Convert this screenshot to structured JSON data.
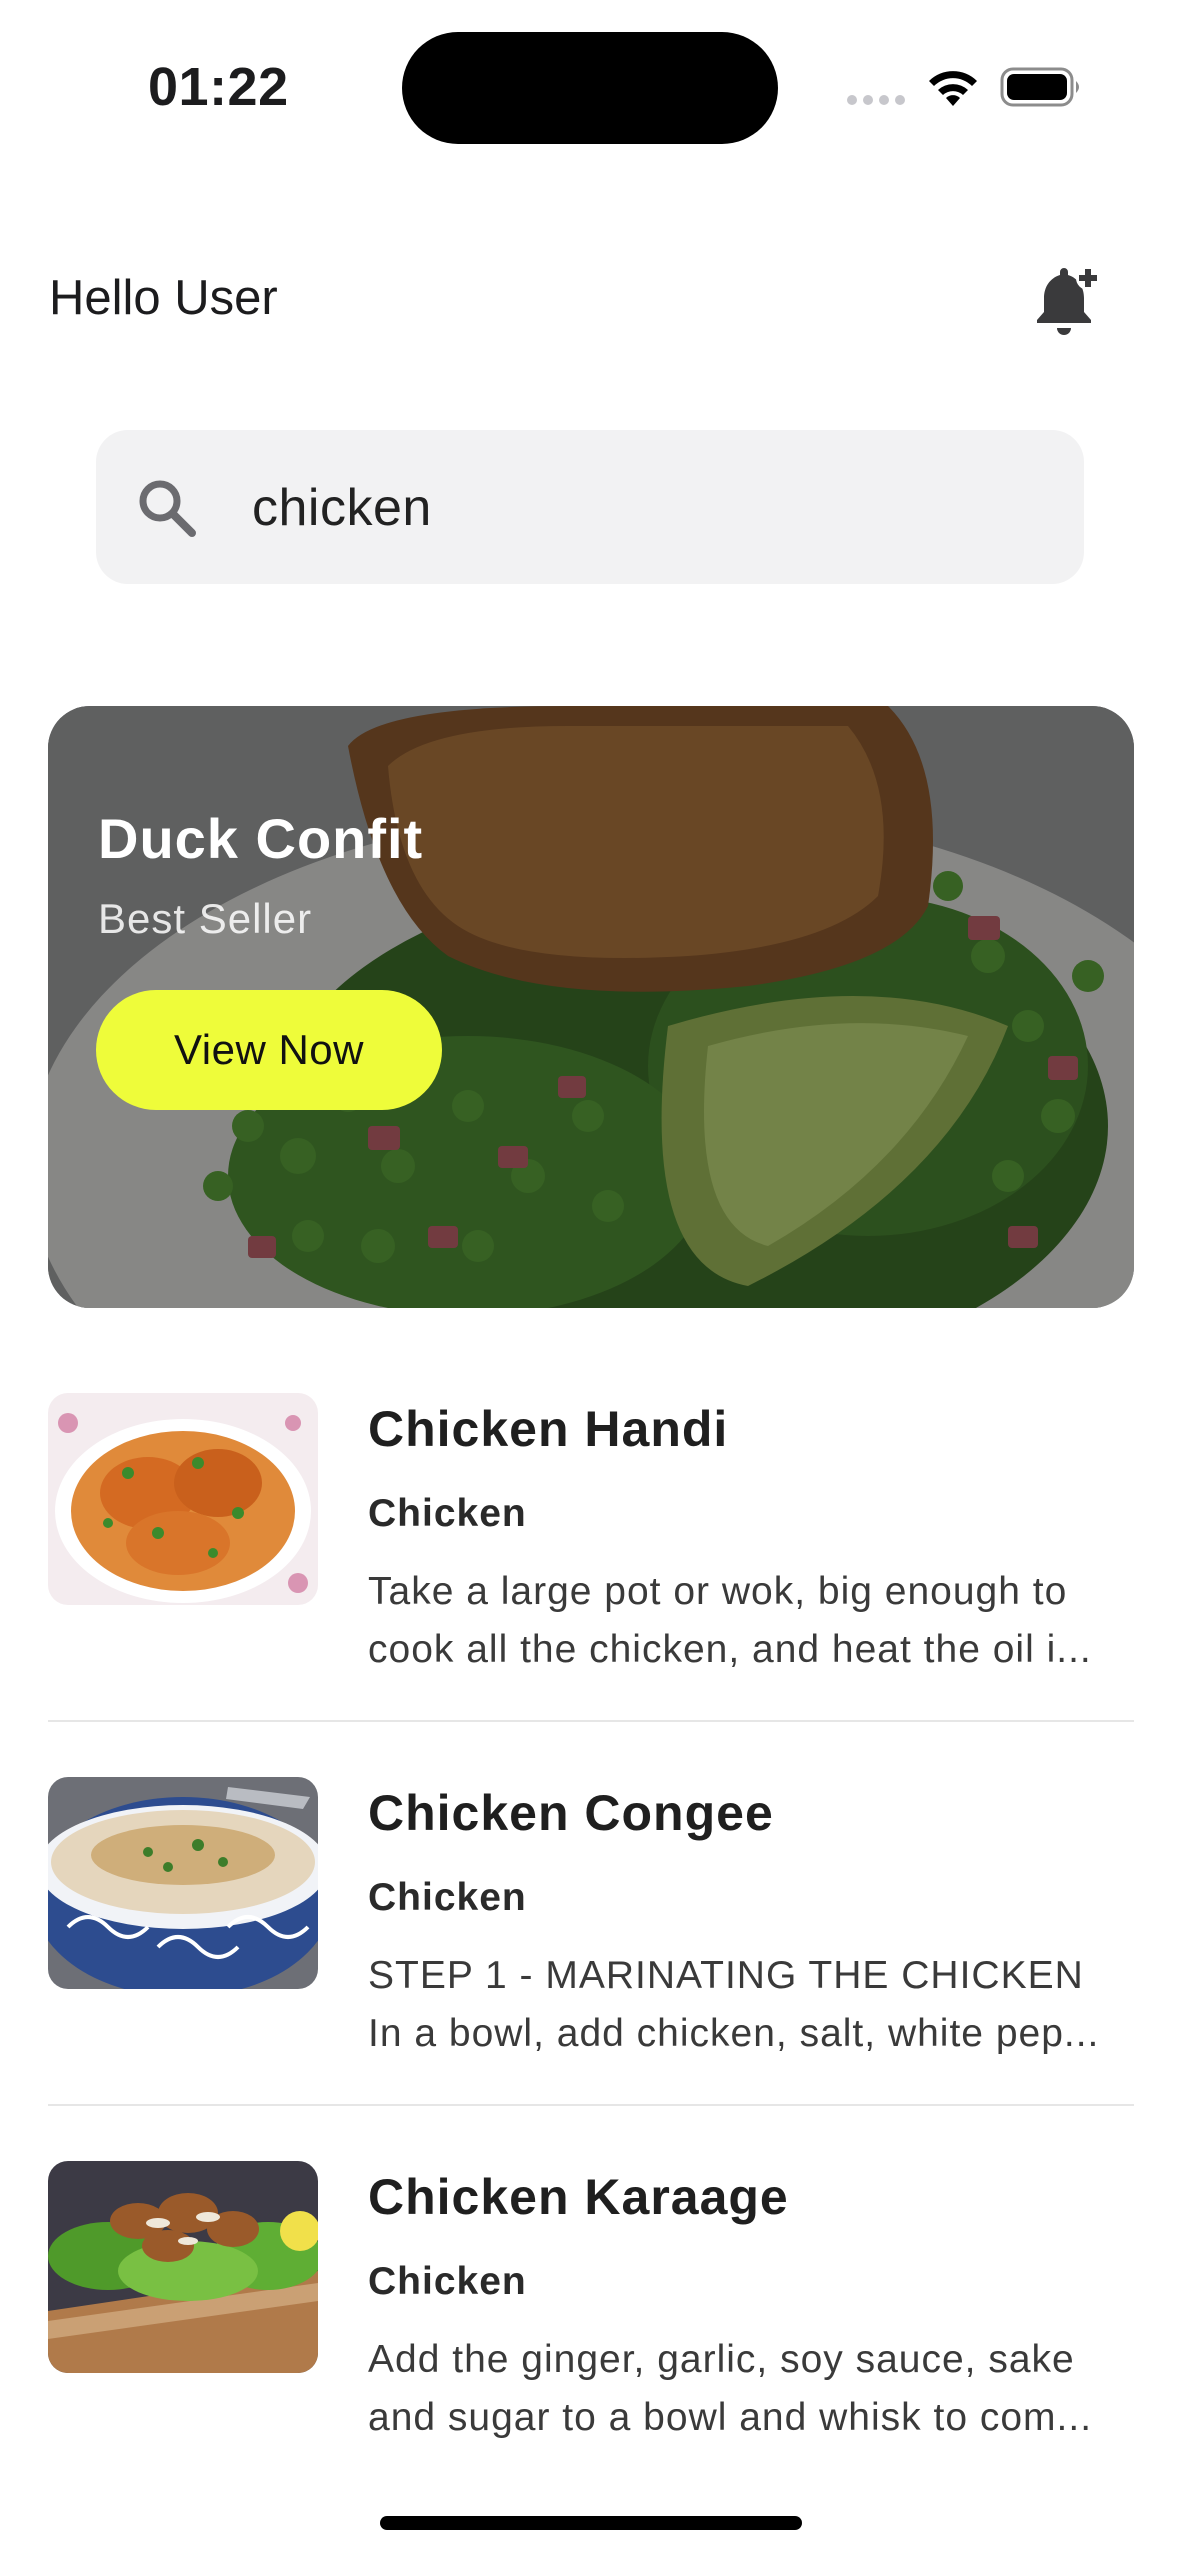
{
  "status_bar": {
    "time": "01:22"
  },
  "header": {
    "greeting": "Hello User",
    "bell_icon": "bell-plus-icon"
  },
  "search": {
    "value": "chicken",
    "placeholder": "",
    "icon": "search-icon"
  },
  "hero": {
    "title": "Duck Confit",
    "subtitle": "Best Seller",
    "button_label": "View Now",
    "button_color": "#eefc3a"
  },
  "recipes": [
    {
      "title": "Chicken Handi",
      "category": "Chicken",
      "description_line1": "Take a large pot or wok, big enough to",
      "description_line2": "cook all the chicken, and heat the oil i..."
    },
    {
      "title": "Chicken Congee",
      "category": "Chicken",
      "description_line1": "STEP 1 - MARINATING THE CHICKEN",
      "description_line2": "In a bowl, add chicken, salt, white pep..."
    },
    {
      "title": "Chicken Karaage",
      "category": "Chicken",
      "description_line1": "Add the ginger, garlic, soy sauce, sake",
      "description_line2": "and sugar to a bowl and whisk to com..."
    }
  ]
}
